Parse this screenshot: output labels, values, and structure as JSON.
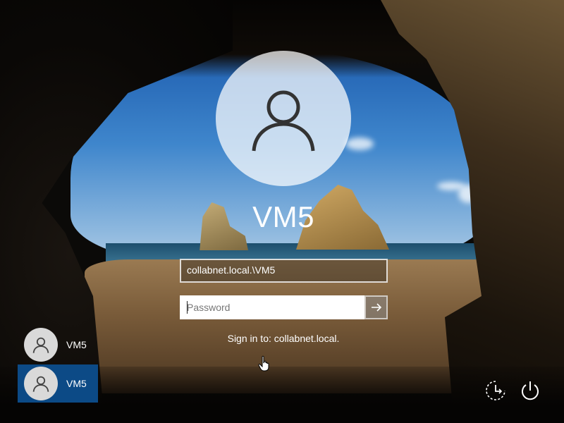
{
  "login": {
    "username": "VM5",
    "domain_user": "collabnet.local.\\VM5",
    "password_placeholder": "Password",
    "sign_in_to": "Sign in to: collabnet.local."
  },
  "users": [
    {
      "name": "VM5",
      "selected": false
    },
    {
      "name": "VM5",
      "selected": true
    }
  ],
  "icons": {
    "avatar": "user-silhouette-icon",
    "submit": "arrow-right-icon",
    "ease_of_access": "ease-of-access-icon",
    "power": "power-icon",
    "pointer": "hand-pointer-icon"
  },
  "colors": {
    "selected_tile": "#0c4a86",
    "avatar_circle": "#ffffff"
  }
}
